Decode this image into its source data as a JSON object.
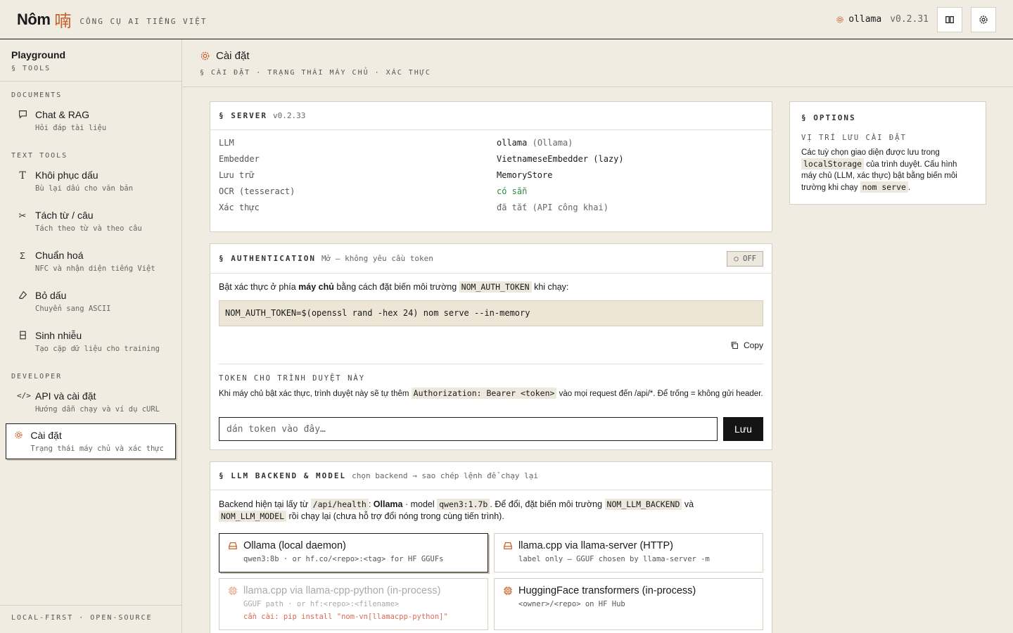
{
  "header": {
    "brand": "Nôm",
    "brand_glyph": "喃",
    "tagline": "CÔNG CỤ AI TIẾNG VIỆT",
    "backend": "ollama",
    "version": "v0.2.31",
    "icons": [
      "gear-icon",
      "book-icon",
      "settings-icon"
    ]
  },
  "sidebar": {
    "title": "Playground",
    "subtitle": "§ TOOLS",
    "sections": {
      "documents": "DOCUMENTS",
      "text_tools": "TEXT TOOLS",
      "developer": "DEVELOPER"
    },
    "items": [
      {
        "label": "Chat & RAG",
        "desc": "Hỏi đáp tài liệu",
        "icon": "chat-icon"
      },
      {
        "label": "Khôi phục dấu",
        "desc": "Bù lại dấu cho văn bản",
        "icon": "text-icon"
      },
      {
        "label": "Tách từ / câu",
        "desc": "Tách theo từ và theo câu",
        "icon": "scissors-icon"
      },
      {
        "label": "Chuẩn hoá",
        "desc": "NFC và nhận diện tiếng Việt",
        "icon": "sigma-icon"
      },
      {
        "label": "Bỏ dấu",
        "desc": "Chuyển sang ASCII",
        "icon": "eraser-icon"
      },
      {
        "label": "Sinh nhiễu",
        "desc": "Tạo cặp dữ liệu cho training",
        "icon": "data-icon"
      },
      {
        "label": "API và cài đặt",
        "desc": "Hướng dẫn chạy và ví dụ cURL",
        "icon": "code-icon"
      },
      {
        "label": "Cài đặt",
        "desc": "Trạng thái máy chủ và xác thực",
        "icon": "gear-icon"
      }
    ],
    "footer": "LOCAL-FIRST · OPEN-SOURCE"
  },
  "main": {
    "title": "Cài đặt",
    "breadcrumb": "§ CÀI ĐẶT · TRẠNG THÁI MÁY CHỦ · XÁC THỰC"
  },
  "server": {
    "title": "§ SERVER",
    "version": "v0.2.33",
    "rows": [
      {
        "key": "LLM",
        "value": "ollama",
        "extra": "(Ollama)"
      },
      {
        "key": "Embedder",
        "value": "VietnameseEmbedder (lazy)",
        "extra": ""
      },
      {
        "key": "Lưu trữ",
        "value": "MemoryStore",
        "extra": ""
      },
      {
        "key": "OCR (tesseract)",
        "value": "có sẵn",
        "extra": ""
      },
      {
        "key": "Xác thực",
        "value": "đã tắt (API công khai)",
        "extra": ""
      }
    ]
  },
  "auth": {
    "title": "§ AUTHENTICATION",
    "subtitle": "Mở — không yêu cầu token",
    "badge": "OFF",
    "intro_a": "Bật xác thực ở phía ",
    "intro_b": "máy chủ",
    "intro_c": " bằng cách đặt biến môi trường ",
    "intro_code": "NOM_AUTH_TOKEN",
    "intro_d": " khi chạy:",
    "command": "NOM_AUTH_TOKEN=$(openssl rand -hex 24) nom serve --in-memory",
    "copy_label": "Copy",
    "token_label": "TOKEN CHO TRÌNH DUYỆT NÀY",
    "token_help_a": "Khi máy chủ bật xác thực, trình duyệt này sẽ tự thêm ",
    "token_help_code": "Authorization: Bearer <token>",
    "token_help_b": " vào mọi request đến /api/*. Để trống = không gửi header.",
    "token_placeholder": "dán token vào đây…",
    "save_label": "Lưu"
  },
  "llm": {
    "title": "§ LLM BACKEND & MODEL",
    "subtitle": "chọn backend → sao chép lệnh để chạy lại",
    "desc_a": "Backend hiện tại lấy từ ",
    "desc_code1": "/api/health",
    "desc_b": ": ",
    "desc_strong": "Ollama",
    "desc_c": " · model ",
    "desc_code2": "qwen3:1.7b",
    "desc_d": ". Để đổi, đặt biến môi trường ",
    "desc_code3": "NOM_LLM_BACKEND",
    "desc_e": " và ",
    "desc_code4": "NOM_LLM_MODEL",
    "desc_f": " rồi chạy lại (chưa hỗ trợ đổi nóng trong cùng tiến trình).",
    "backends": [
      {
        "name": "Ollama (local daemon)",
        "hint": "qwen3:8b · or hf.co/<repo>:<tag> for HF GGUFs",
        "warn": "",
        "icon": "drive-icon"
      },
      {
        "name": "llama.cpp via llama-server (HTTP)",
        "hint": "label only — GGUF chosen by llama-server -m",
        "warn": "",
        "icon": "drive-icon"
      },
      {
        "name": "llama.cpp via llama-cpp-python (in-process)",
        "hint": "GGUF path · or hf:<repo>:<filename>",
        "warn": "cần cài: pip install \"nom-vn[llamacpp-python]\"",
        "icon": "chip-icon"
      },
      {
        "name": "HuggingFace transformers (in-process)",
        "hint": "<owner>/<repo> on HF Hub",
        "warn": "",
        "icon": "chip-icon"
      }
    ]
  },
  "options": {
    "title": "§ OPTIONS",
    "label": "VỊ TRÍ LƯU CÀI ĐẶT",
    "text_a": "Các tuỳ chọn giao diện được lưu trong ",
    "code1": "localStorage",
    "text_b": " của trình duyệt. Cấu hình máy chủ (LLM, xác thực) bật bằng biến môi trường khi chạy ",
    "code2": "nom serve",
    "text_c": "."
  },
  "colors": {
    "accent": "#c8602a",
    "background": "#f0ece2",
    "ok": "#2f8a3c",
    "warn": "#d96b5a"
  }
}
